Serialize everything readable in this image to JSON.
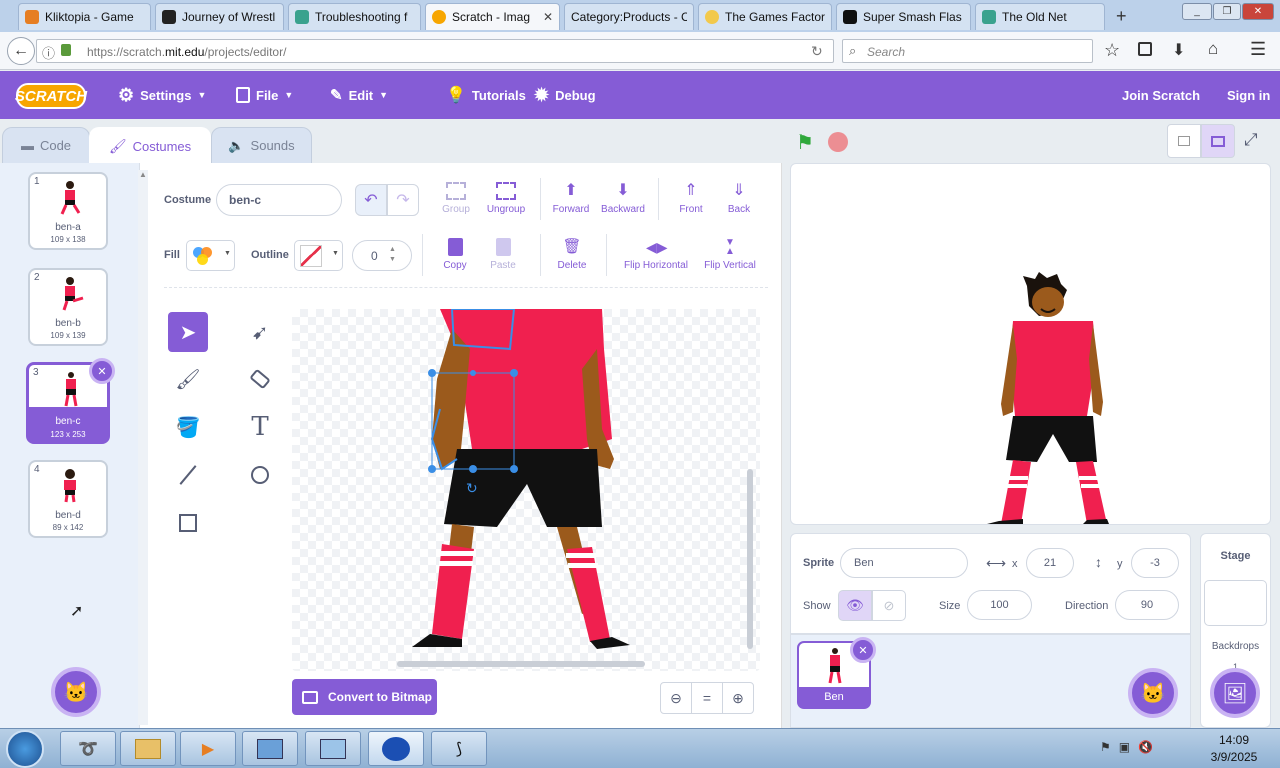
{
  "browser": {
    "tabs": [
      {
        "label": "Kliktopia - Game",
        "color": "#e67e22"
      },
      {
        "label": "Journey of Wrestl",
        "color": "#222"
      },
      {
        "label": "Troubleshooting f",
        "color": "#3aa28e"
      },
      {
        "label": "Scratch - Imag",
        "color": "#f7a600",
        "active": true
      },
      {
        "label": "Category:Products - C",
        "color": "#cccccc"
      },
      {
        "label": "The Games Factor",
        "color": "#f2c94c"
      },
      {
        "label": "Super Smash Flas",
        "color": "#111"
      },
      {
        "label": "The Old Net",
        "color": "#3aa28e"
      }
    ],
    "url_prefix": "https://scratch.",
    "url_domain": "mit.edu",
    "url_suffix": "/projects/editor/",
    "search_placeholder": "Search"
  },
  "menu": {
    "logo": "SCRATCH",
    "settings": "Settings",
    "file": "File",
    "edit": "Edit",
    "tutorials": "Tutorials",
    "debug": "Debug",
    "join": "Join Scratch",
    "signin": "Sign in"
  },
  "tabs": {
    "code": "Code",
    "costumes": "Costumes",
    "sounds": "Sounds"
  },
  "costumes": [
    {
      "num": "1",
      "name": "ben-a",
      "dim": "109 x 138"
    },
    {
      "num": "2",
      "name": "ben-b",
      "dim": "109 x 139"
    },
    {
      "num": "3",
      "name": "ben-c",
      "dim": "123 x 253"
    },
    {
      "num": "4",
      "name": "ben-d",
      "dim": "89 x 142"
    }
  ],
  "toolbar": {
    "costume_label": "Costume",
    "costume_name": "ben-c",
    "group": "Group",
    "ungroup": "Ungroup",
    "forward": "Forward",
    "backward": "Backward",
    "front": "Front",
    "back": "Back",
    "fill": "Fill",
    "outline": "Outline",
    "outline_width": "0",
    "copy": "Copy",
    "paste": "Paste",
    "delete": "Delete",
    "flip_h": "Flip Horizontal",
    "flip_v": "Flip Vertical"
  },
  "convert": "Convert to Bitmap",
  "sprite": {
    "label": "Sprite",
    "name": "Ben",
    "x_label": "x",
    "x": "21",
    "y_label": "y",
    "y": "-3",
    "show": "Show",
    "size_label": "Size",
    "size": "100",
    "direction_label": "Direction",
    "direction": "90",
    "thumb_name": "Ben"
  },
  "stagepanel": {
    "title": "Stage",
    "backdrops": "Backdrops",
    "count": "1"
  },
  "clock": {
    "time": "14:09",
    "date": "3/9/2025"
  },
  "colors": {
    "accent": "#855cd6",
    "shirt": "#f0204f",
    "skin": "#9b5a1c",
    "shorts": "#111111"
  }
}
